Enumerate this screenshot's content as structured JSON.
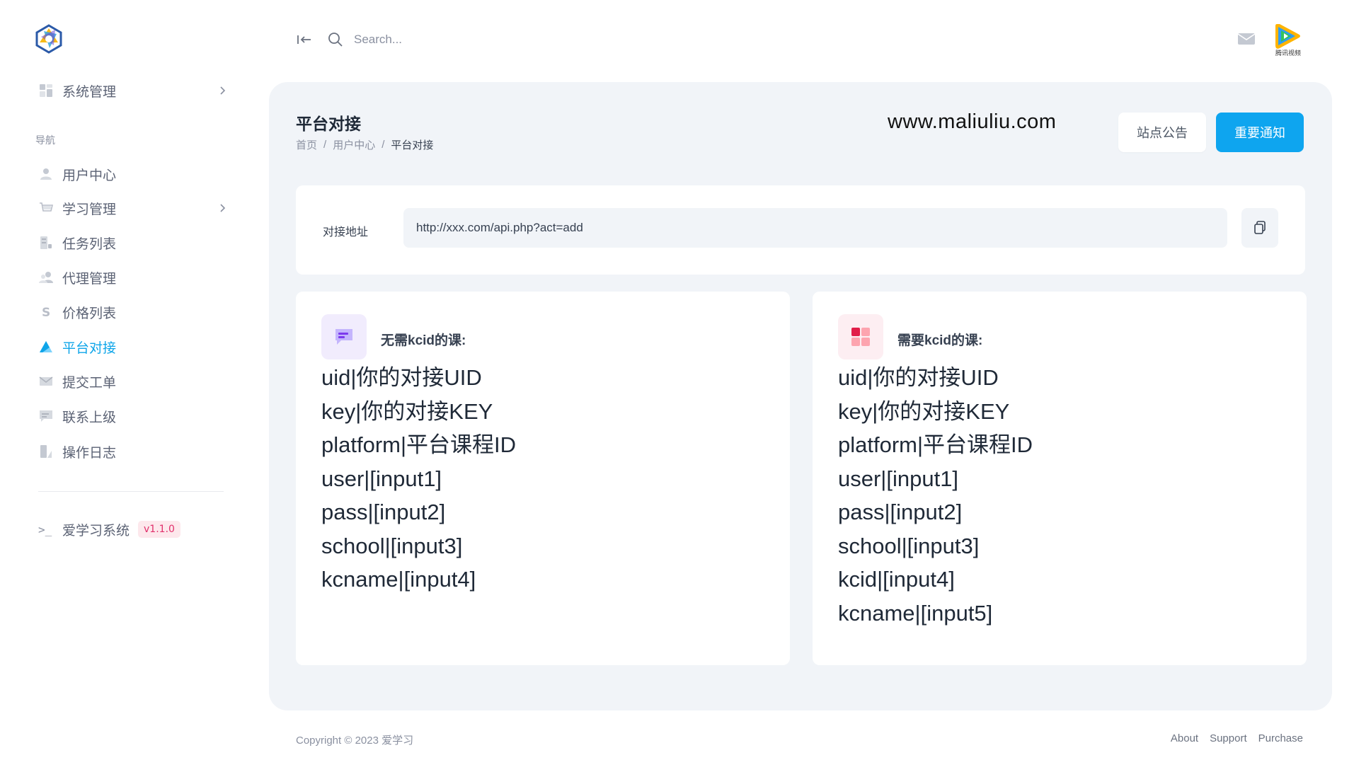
{
  "sidebar": {
    "logo": "app-logo",
    "nav_heading": "导航",
    "items": [
      {
        "label": "系统管理",
        "icon": "grid-icon",
        "has_children": true
      },
      {
        "label": "用户中心",
        "icon": "user-icon",
        "has_children": false
      },
      {
        "label": "学习管理",
        "icon": "cart-icon",
        "has_children": true
      },
      {
        "label": "任务列表",
        "icon": "task-list-icon",
        "has_children": false
      },
      {
        "label": "代理管理",
        "icon": "users-icon",
        "has_children": false
      },
      {
        "label": "价格列表",
        "icon": "dollar-icon",
        "has_children": false
      },
      {
        "label": "平台对接",
        "icon": "triangle-icon",
        "has_children": false,
        "active": true
      },
      {
        "label": "提交工单",
        "icon": "mail-icon",
        "has_children": false
      },
      {
        "label": "联系上级",
        "icon": "chat-icon",
        "has_children": false
      },
      {
        "label": "操作日志",
        "icon": "log-icon",
        "has_children": false
      }
    ],
    "app_name": "爱学习系统",
    "version": "v1.1.0"
  },
  "topbar": {
    "search_placeholder": "Search...",
    "avatar_caption": "腾讯视频"
  },
  "page": {
    "title": "平台对接",
    "breadcrumb": [
      "首页",
      "用户中心",
      "平台对接"
    ],
    "site_url": "www.maliuliu.com",
    "announce_button": "站点公告",
    "notice_button": "重要通知"
  },
  "endpoint": {
    "label": "对接地址",
    "value": "http://xxx.com/api.php?act=add"
  },
  "cards": {
    "without_kcid": {
      "title": "无需kcid的课:",
      "params": [
        "uid|你的对接UID",
        "key|你的对接KEY",
        "platform|平台课程ID",
        "user|[input1]",
        "pass|[input2]",
        "school|[input3]",
        "kcname|[input4]"
      ]
    },
    "with_kcid": {
      "title": "需要kcid的课:",
      "params": [
        "uid|你的对接UID",
        "key|你的对接KEY",
        "platform|平台课程ID",
        "user|[input1]",
        "pass|[input2]",
        "school|[input3]",
        "kcid|[input4]",
        "kcname|[input5]"
      ]
    }
  },
  "footer": {
    "copyright": "Copyright © 2023 爱学习",
    "links": [
      "About",
      "Support",
      "Purchase"
    ]
  },
  "colors": {
    "accent": "#0ea5ef",
    "panel_bg": "#f1f4f8",
    "badge_bg": "#fde8ec",
    "badge_text": "#e1306c"
  }
}
